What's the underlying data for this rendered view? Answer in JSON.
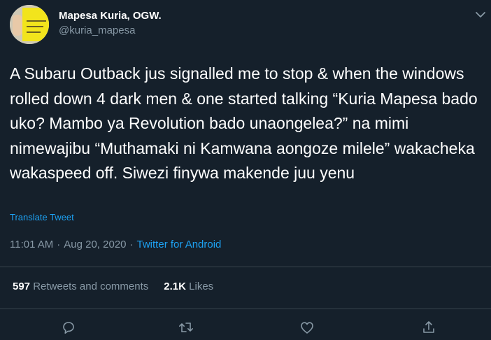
{
  "user": {
    "name": "Mapesa Kuria, OGW.",
    "handle": "@kuria_mapesa"
  },
  "tweet": {
    "text": "A Subaru Outback jus signalled me to stop & when the windows rolled down 4 dark men & one started talking “Kuria Mapesa bado uko? Mambo ya Revolution bado unaongelea?” na mimi nimewajibu “Muthamaki ni Kamwana aongoze milele” wakacheka wakaspeed off. Siwezi finywa makende juu yenu",
    "translate_label": "Translate Tweet"
  },
  "meta": {
    "time": "11:01 AM",
    "separator": "·",
    "date": "Aug 20, 2020",
    "source": "Twitter for Android"
  },
  "stats": {
    "retweets_count": "597",
    "retweets_label": "Retweets and comments",
    "likes_count": "2.1K",
    "likes_label": "Likes"
  },
  "icons": {
    "caret": "chevron-down-icon",
    "reply": "reply-icon",
    "retweet": "retweet-icon",
    "like": "heart-icon",
    "share": "share-icon"
  },
  "colors": {
    "background": "#15202b",
    "secondary_text": "#8899a6",
    "accent": "#1da1f2",
    "divider": "#38444d"
  }
}
